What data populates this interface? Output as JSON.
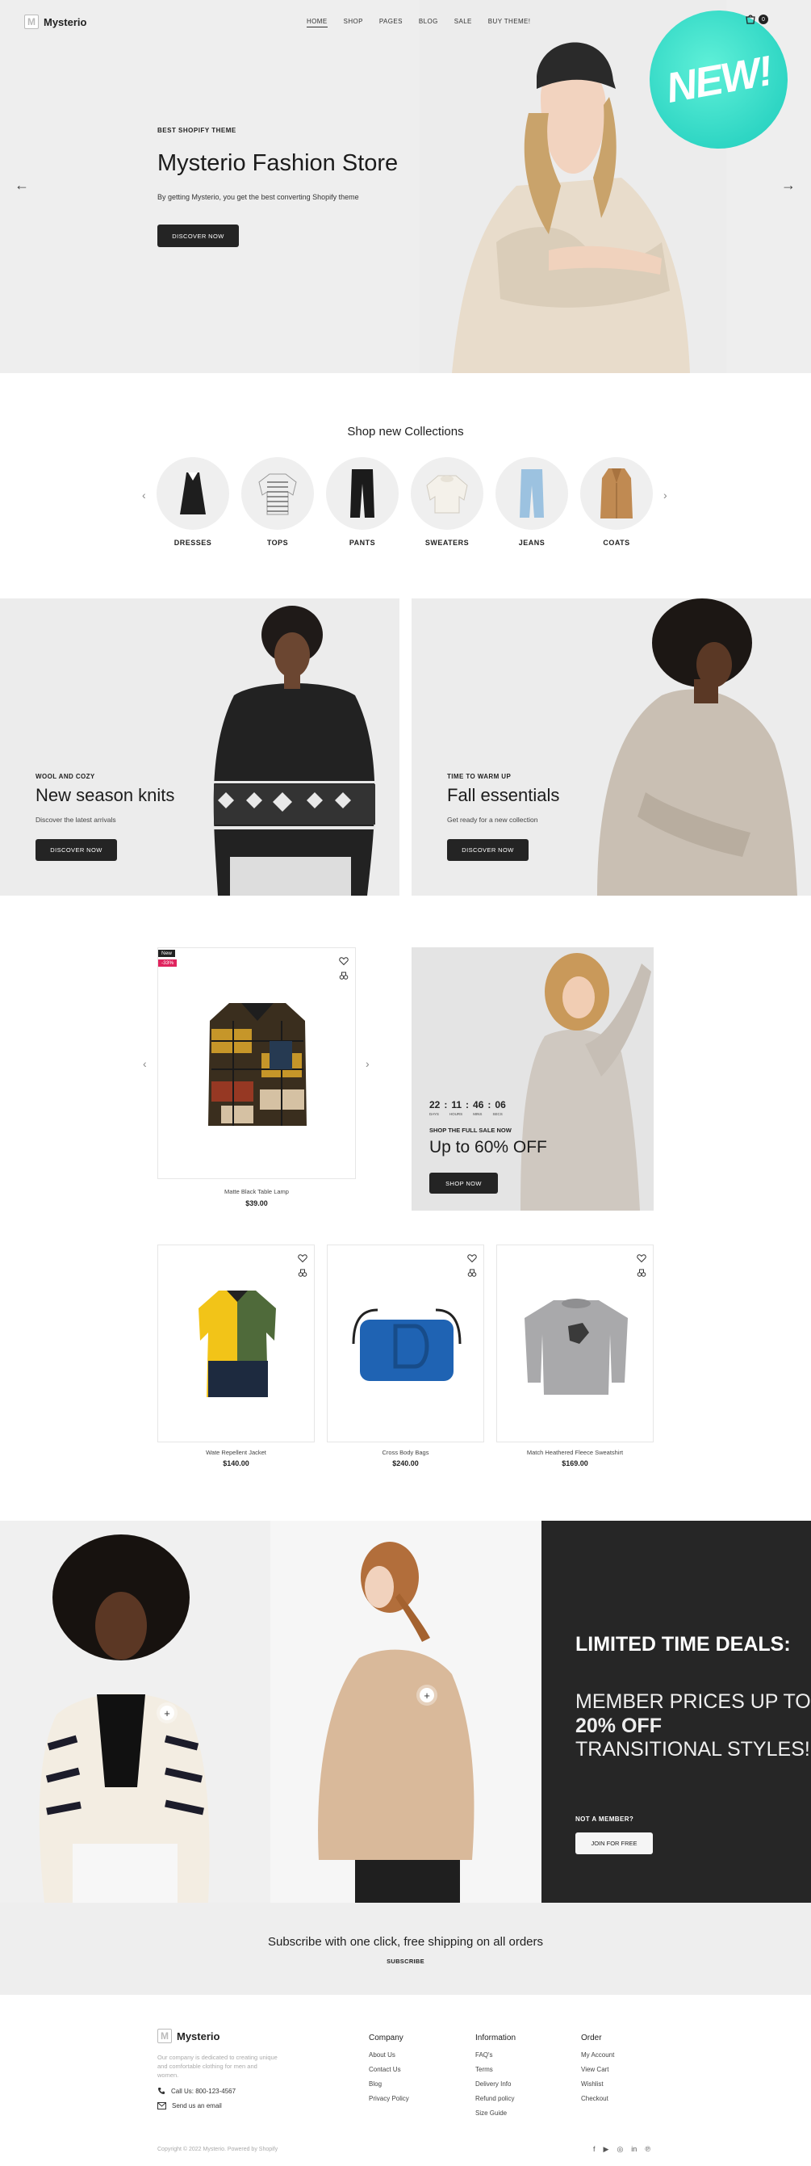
{
  "brand": {
    "logo_letter": "M",
    "name": "Mysterio"
  },
  "nav": {
    "items": [
      "HOME",
      "SHOP",
      "PAGES",
      "BLOG",
      "SALE",
      "BUY THEME!"
    ],
    "active": "HOME"
  },
  "header": {
    "cart_count": "0"
  },
  "hero": {
    "kicker": "BEST SHOPIFY THEME",
    "title": "Mysterio Fashion Store",
    "text": "By getting Mysterio, you get the best converting Shopify theme",
    "button": "DISCOVER NOW",
    "badge": "NEW!",
    "prev_arrow": "←",
    "next_arrow": "→"
  },
  "collections": {
    "title": "Shop new Collections",
    "items": [
      "DRESSES",
      "TOPS",
      "PANTS",
      "SWEATERS",
      "JEANS",
      "COATS"
    ],
    "prev": "‹",
    "next": "›"
  },
  "banners": [
    {
      "kicker": "WOOL AND COZY",
      "title": "New season knits",
      "text": "Discover the latest arrivals",
      "button": "DISCOVER NOW"
    },
    {
      "kicker": "TIME TO WARM UP",
      "title": "Fall essentials",
      "text": "Get ready for a new collection",
      "button": "DISCOVER NOW"
    }
  ],
  "featured_product": {
    "badge_new": "New",
    "badge_sale": "-33%",
    "name": "Matte Black Table Lamp",
    "price": "$39.00",
    "prev": "‹",
    "next": "›"
  },
  "sale_banner": {
    "countdown": [
      "22",
      "11",
      "46",
      "06"
    ],
    "separator": ":",
    "countdown_labels": [
      "DAYS",
      "HOURS",
      "MINS",
      "SECS"
    ],
    "kicker": "SHOP THE FULL SALE NOW",
    "title": "Up to 60% OFF",
    "button": "SHOP NOW"
  },
  "products": [
    {
      "name": "Wate Repellent Jacket",
      "price": "$140.00"
    },
    {
      "name": "Cross Body Bags",
      "price": "$240.00"
    },
    {
      "name": "Match Heathered Fleece Sweatshirt",
      "price": "$169.00"
    }
  ],
  "lookbook": {
    "title": "LIMITED TIME DEALS:",
    "sub_pre": "MEMBER PRICES UP TO ",
    "sub_bold": "20% OFF",
    "sub_post": " TRANSITIONAL STYLES!",
    "kicker": "NOT A MEMBER?",
    "button": "JOIN FOR FREE",
    "hotspot": "+"
  },
  "subscribe": {
    "title": "Subscribe with one click, free shipping on all orders",
    "link": "SUBSCRIBE"
  },
  "footer": {
    "description": "Our company is dedicated to creating unique and comfortable clothing for men and women.",
    "phone": "Call Us: 800-123-4567",
    "email": "Send us an email",
    "columns": [
      {
        "title": "Company",
        "links": [
          "About Us",
          "Contact Us",
          "Blog",
          "Privacy Policy"
        ]
      },
      {
        "title": "Information",
        "links": [
          "FAQ's",
          "Terms",
          "Delivery Info",
          "Refund policy",
          "Size Guide"
        ]
      },
      {
        "title": "Order",
        "links": [
          "My Account",
          "View Cart",
          "Wishlist",
          "Checkout"
        ]
      }
    ],
    "copyright": "Copyright © 2022 Mysterio. Powered by Shopify",
    "socials": [
      "f",
      "▶",
      "◎",
      "in",
      "℗"
    ]
  },
  "colors": {
    "accent_new": "#2fd6c4",
    "sale_badge": "#e0245e",
    "dark": "#242424"
  }
}
